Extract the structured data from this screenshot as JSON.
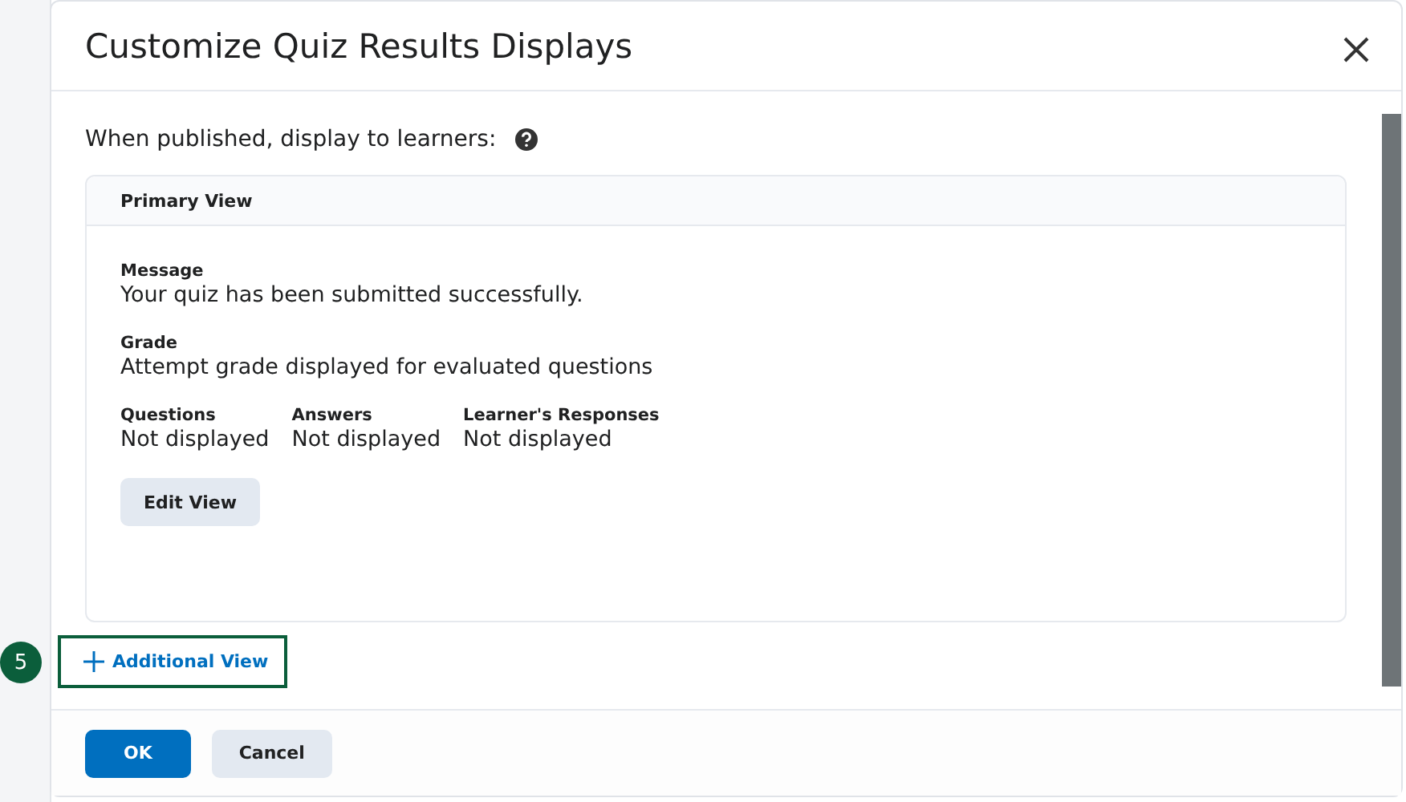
{
  "dialog": {
    "title": "Customize Quiz Results Displays"
  },
  "prompt": "When published, display to learners:",
  "view_card": {
    "title": "Primary View",
    "fields": [
      {
        "label": "Message",
        "value": "Your quiz has been submitted successfully."
      },
      {
        "label": "Grade",
        "value": "Attempt grade displayed for evaluated questions"
      }
    ],
    "columns": [
      {
        "label": "Questions",
        "value": "Not displayed"
      },
      {
        "label": "Answers",
        "value": "Not displayed"
      },
      {
        "label": "Learner's Responses",
        "value": "Not displayed"
      }
    ],
    "button": "Edit View"
  },
  "add_link": {
    "label": "Additional View",
    "callout": "5"
  },
  "buttons": [
    {
      "label": "OK",
      "kind": "primary"
    },
    {
      "label": "Cancel",
      "kind": "secondary"
    }
  ]
}
